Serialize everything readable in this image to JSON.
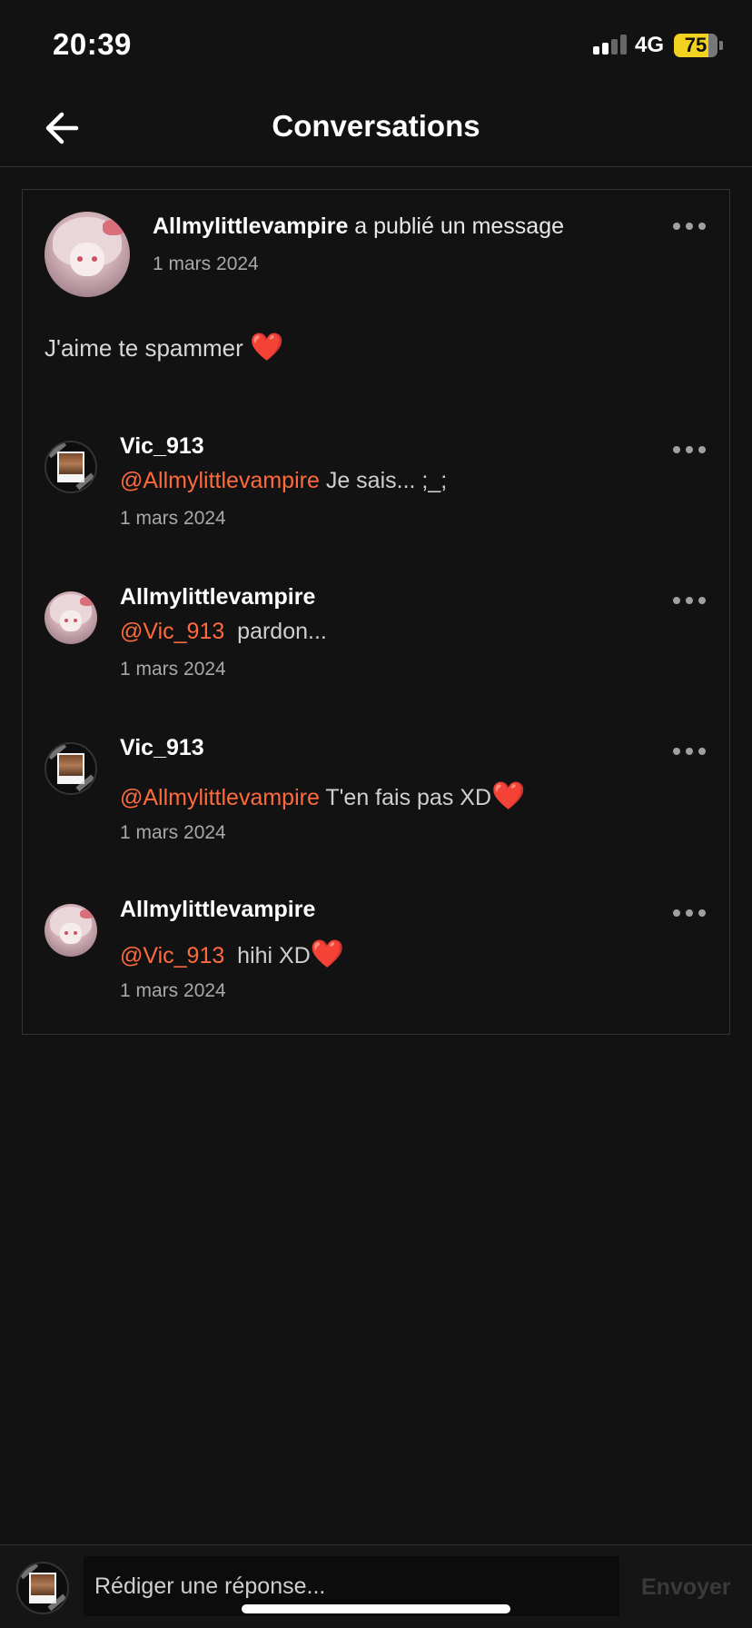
{
  "status_bar": {
    "time": "20:39",
    "network": "4G",
    "battery": "75",
    "battery_color": "#f2d21f"
  },
  "header": {
    "title": "Conversations"
  },
  "post": {
    "author": "Allmylittlevampire",
    "action": " a publié un message",
    "date": "1 mars 2024",
    "body": "J'aime te spammer ",
    "body_emoji": "❤️"
  },
  "comments": [
    {
      "author": "Vic_913",
      "mention": "@Allmylittlevampire",
      "text": " Je sais... ;_;",
      "emoji": "",
      "date": "1 mars 2024"
    },
    {
      "author": "Allmylittlevampire",
      "mention": "@Vic_913",
      "text": "  pardon...",
      "emoji": "",
      "date": "1 mars 2024"
    },
    {
      "author": "Vic_913",
      "mention": "@Allmylittlevampire",
      "text": " T'en fais pas XD",
      "emoji": "❤️",
      "date": "1 mars 2024"
    },
    {
      "author": "Allmylittlevampire",
      "mention": "@Vic_913",
      "text": "  hihi XD",
      "emoji": "❤️",
      "date": "1 mars 2024"
    }
  ],
  "reply_bar": {
    "placeholder": "Rédiger une réponse...",
    "send_label": "Envoyer"
  },
  "colors": {
    "background": "#121212",
    "mention": "#ff6a3d",
    "heart": "#e0242e"
  },
  "icons": {
    "back": "arrow-left-icon",
    "more": "more-dots-icon"
  }
}
